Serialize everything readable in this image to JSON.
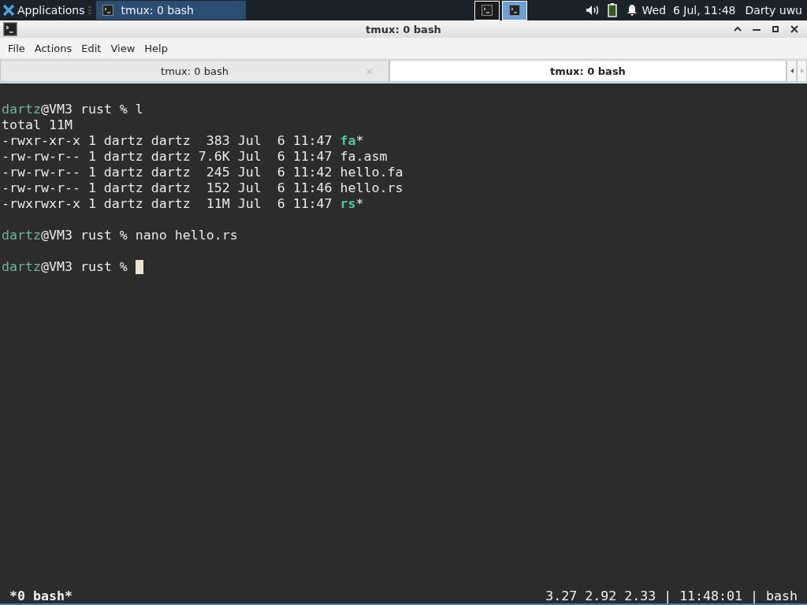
{
  "panel": {
    "app_menu": "Applications",
    "tasks": [
      {
        "label": "tmux: 0 bash",
        "selected": true
      }
    ],
    "workspaces": [
      {
        "selected": false
      },
      {
        "selected": true
      }
    ],
    "clock": "Wed  6 Jul, 11:48",
    "user": "Darty uwu"
  },
  "window": {
    "title": "tmux: 0 bash"
  },
  "menu": [
    "File",
    "Actions",
    "Edit",
    "View",
    "Help"
  ],
  "tabs": [
    {
      "label": "tmux: 0 bash",
      "selected": false
    },
    {
      "label": "tmux: 0 bash",
      "selected": true
    }
  ],
  "terminal": {
    "lines": [
      {
        "blank_before": true,
        "segments": [
          {
            "kind": "user",
            "text": "dartz"
          },
          {
            "kind": "plain",
            "text": "@VM3 rust % l"
          }
        ]
      },
      {
        "blank_before": false,
        "segments": [
          {
            "kind": "plain",
            "text": "total 11M"
          }
        ]
      },
      {
        "blank_before": false,
        "segments": [
          {
            "kind": "plain",
            "text": "-rwxr-xr-x 1 dartz dartz  383 Jul  6 11:47 "
          },
          {
            "kind": "exec",
            "text": "fa"
          },
          {
            "kind": "plain",
            "text": "*"
          }
        ]
      },
      {
        "blank_before": false,
        "segments": [
          {
            "kind": "plain",
            "text": "-rw-rw-r-- 1 dartz dartz 7.6K Jul  6 11:47 fa.asm"
          }
        ]
      },
      {
        "blank_before": false,
        "segments": [
          {
            "kind": "plain",
            "text": "-rw-rw-r-- 1 dartz dartz  245 Jul  6 11:42 hello.fa"
          }
        ]
      },
      {
        "blank_before": false,
        "segments": [
          {
            "kind": "plain",
            "text": "-rw-rw-r-- 1 dartz dartz  152 Jul  6 11:46 hello.rs"
          }
        ]
      },
      {
        "blank_before": false,
        "segments": [
          {
            "kind": "plain",
            "text": "-rwxrwxr-x 1 dartz dartz  11M Jul  6 11:47 "
          },
          {
            "kind": "exec",
            "text": "rs"
          },
          {
            "kind": "plain",
            "text": "*"
          }
        ]
      },
      {
        "blank_before": true,
        "segments": [
          {
            "kind": "user",
            "text": "dartz"
          },
          {
            "kind": "plain",
            "text": "@VM3 rust % nano hello.rs"
          }
        ]
      },
      {
        "blank_before": true,
        "segments": [
          {
            "kind": "user",
            "text": "dartz"
          },
          {
            "kind": "plain",
            "text": "@VM3 rust % "
          }
        ],
        "cursor": true
      }
    ]
  },
  "status": {
    "left": "*0 bash*",
    "right": "3.27 2.92 2.33 | 11:48:01 | bash"
  }
}
